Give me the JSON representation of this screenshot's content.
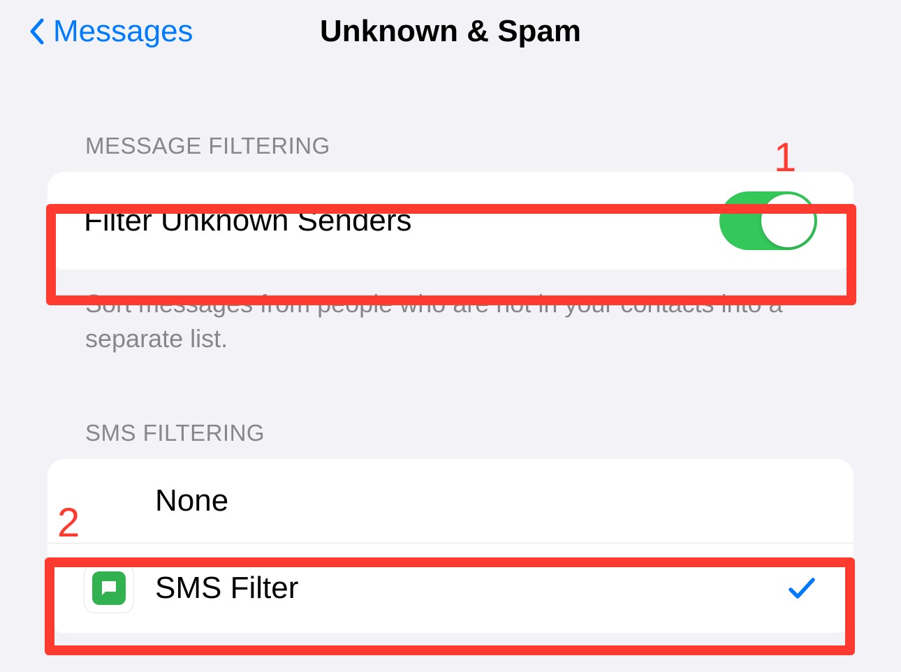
{
  "nav": {
    "back_label": "Messages",
    "title": "Unknown & Spam"
  },
  "message_filtering": {
    "header": "MESSAGE FILTERING",
    "filter_unknown_label": "Filter Unknown Senders",
    "filter_unknown_enabled": true,
    "footer": "Sort messages from people who are not in your contacts into a separate list."
  },
  "sms_filtering": {
    "header": "SMS FILTERING",
    "options": [
      {
        "label": "None",
        "selected": false,
        "has_icon": false
      },
      {
        "label": "SMS Filter",
        "selected": true,
        "has_icon": true
      }
    ]
  },
  "annotations": {
    "callout_1": "1",
    "callout_2": "2"
  }
}
